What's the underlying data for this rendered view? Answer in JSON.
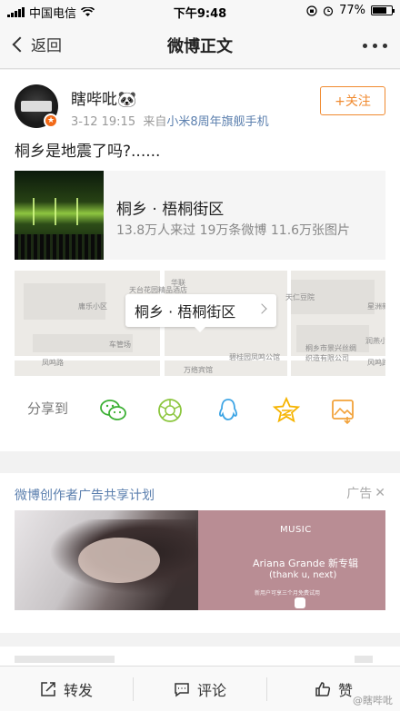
{
  "status_bar": {
    "carrier": "中国电信",
    "time": "下午9:48",
    "battery": "77%",
    "battery_level": 0.77
  },
  "nav": {
    "back_label": "返回",
    "title": "微博正文"
  },
  "post": {
    "username": "瞎哔吡🐼",
    "date": "3-12 19:15",
    "source_prefix": "来自",
    "source": "小米8周年旗舰手机",
    "follow_label": "+关注",
    "text": "桐乡是地震了吗?......",
    "place": {
      "name": "桐乡 · 梧桐街区",
      "stats": "13.8万人来过 19万条微博 11.6万张图片"
    },
    "map": {
      "callout": "桐乡 · 梧桐街区",
      "labels": [
        "天台花园精品酒店",
        "庸乐小区",
        "华联",
        "天仁豆院",
        "星洲新",
        "车管场",
        "凤鸣路",
        "万络宾馆",
        "碧桂园凤鸣公馆",
        "桐乡市景兴丝绸织造有限公司",
        "风鸣路",
        "润燕小区"
      ]
    },
    "share": {
      "label": "分享到",
      "targets": [
        "wechat-icon",
        "moments-icon",
        "qq-icon",
        "qzone-icon",
        "album-icon"
      ]
    }
  },
  "ad": {
    "title": "微博创作者广告共享计划",
    "tag": "广告",
    "music_brand": "MUSIC",
    "artist": "Ariana Grande 新专辑",
    "album": "(thank u, next)",
    "fine_print": "新用户可享三个月免费试用"
  },
  "toolbar": {
    "repost": "转发",
    "comment": "评论",
    "like": "赞"
  },
  "watermark": "@瞎哔吡"
}
